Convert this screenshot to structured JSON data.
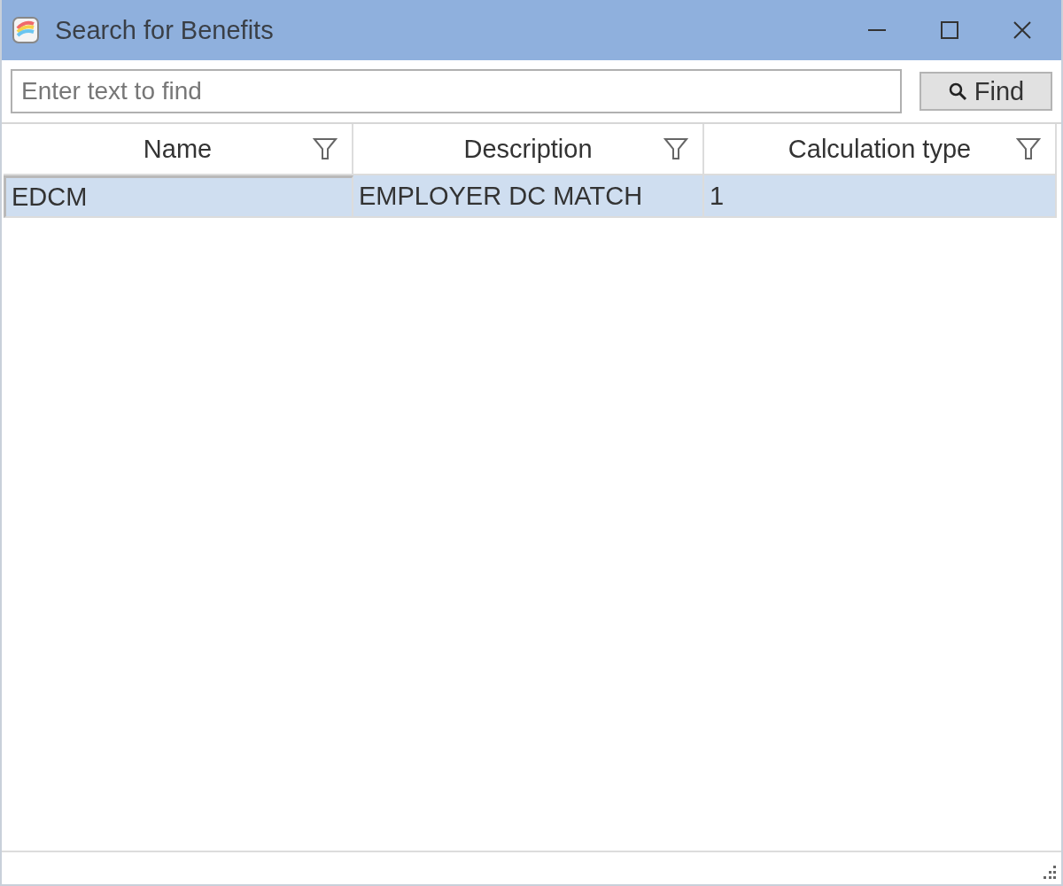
{
  "window": {
    "title": "Search for Benefits"
  },
  "search": {
    "placeholder": "Enter text to find",
    "button": "Find"
  },
  "table": {
    "columns": [
      "Name",
      "Description",
      "Calculation type"
    ],
    "rows": [
      {
        "selected": true,
        "cells": [
          "EDCM",
          "EMPLOYER DC MATCH",
          "1"
        ]
      }
    ]
  }
}
